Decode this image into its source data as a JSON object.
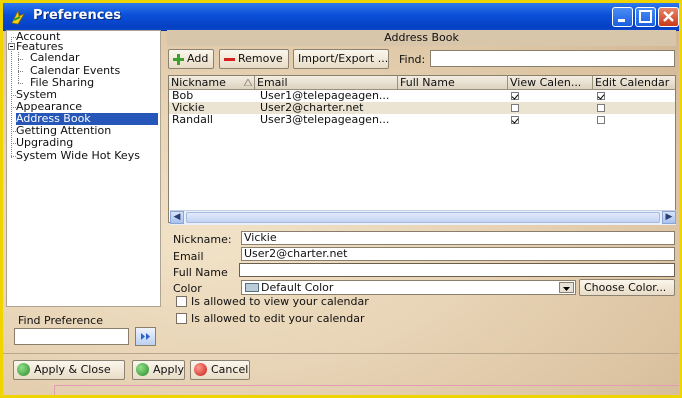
{
  "window": {
    "title": "Preferences"
  },
  "tree": {
    "items": [
      {
        "label": "Account"
      },
      {
        "label": "Features"
      },
      {
        "label": "Calendar"
      },
      {
        "label": "Calendar Events"
      },
      {
        "label": "File Sharing"
      },
      {
        "label": "System"
      },
      {
        "label": "Appearance"
      },
      {
        "label": "Address Book"
      },
      {
        "label": "Getting Attention"
      },
      {
        "label": "Upgrading"
      },
      {
        "label": "System Wide Hot Keys"
      }
    ],
    "selected": "Address Book"
  },
  "find_preference": {
    "label": "Find Preference",
    "value": ""
  },
  "address_book": {
    "header": "Address Book",
    "toolbar": {
      "add": "Add",
      "remove": "Remove",
      "import_export": "Import/Export ...",
      "find_label": "Find:",
      "find_value": ""
    },
    "columns": [
      "Nickname",
      "Email",
      "Full Name",
      "View Calen...",
      "Edit Calendar"
    ],
    "rows": [
      {
        "nickname": "Bob",
        "email": "User1@telepageagen...",
        "full_name": "",
        "view": true,
        "edit": true
      },
      {
        "nickname": "Vickie",
        "email": "User2@charter.net",
        "full_name": "",
        "view": false,
        "edit": false
      },
      {
        "nickname": "Randall",
        "email": "User3@telepageagen...",
        "full_name": "",
        "view": true,
        "edit": false
      }
    ],
    "selected_row": 1
  },
  "details": {
    "nickname_label": "Nickname:",
    "nickname_value": "Vickie",
    "email_label": "Email",
    "email_value": "User2@charter.net",
    "fullname_label": "Full Name",
    "fullname_value": "",
    "color_label": "Color",
    "color_value": "Default Color",
    "choose_color": "Choose Color...",
    "allow_view": "Is allowed to view your calendar",
    "allow_edit": "Is allowed to edit your calendar",
    "allow_view_checked": false,
    "allow_edit_checked": false
  },
  "buttons": {
    "apply_close": "Apply & Close",
    "apply": "Apply",
    "cancel": "Cancel"
  },
  "colors": {
    "title_bar": "#0a4fd8",
    "selection": "#2556b8",
    "frame_border": "#f0d400"
  }
}
